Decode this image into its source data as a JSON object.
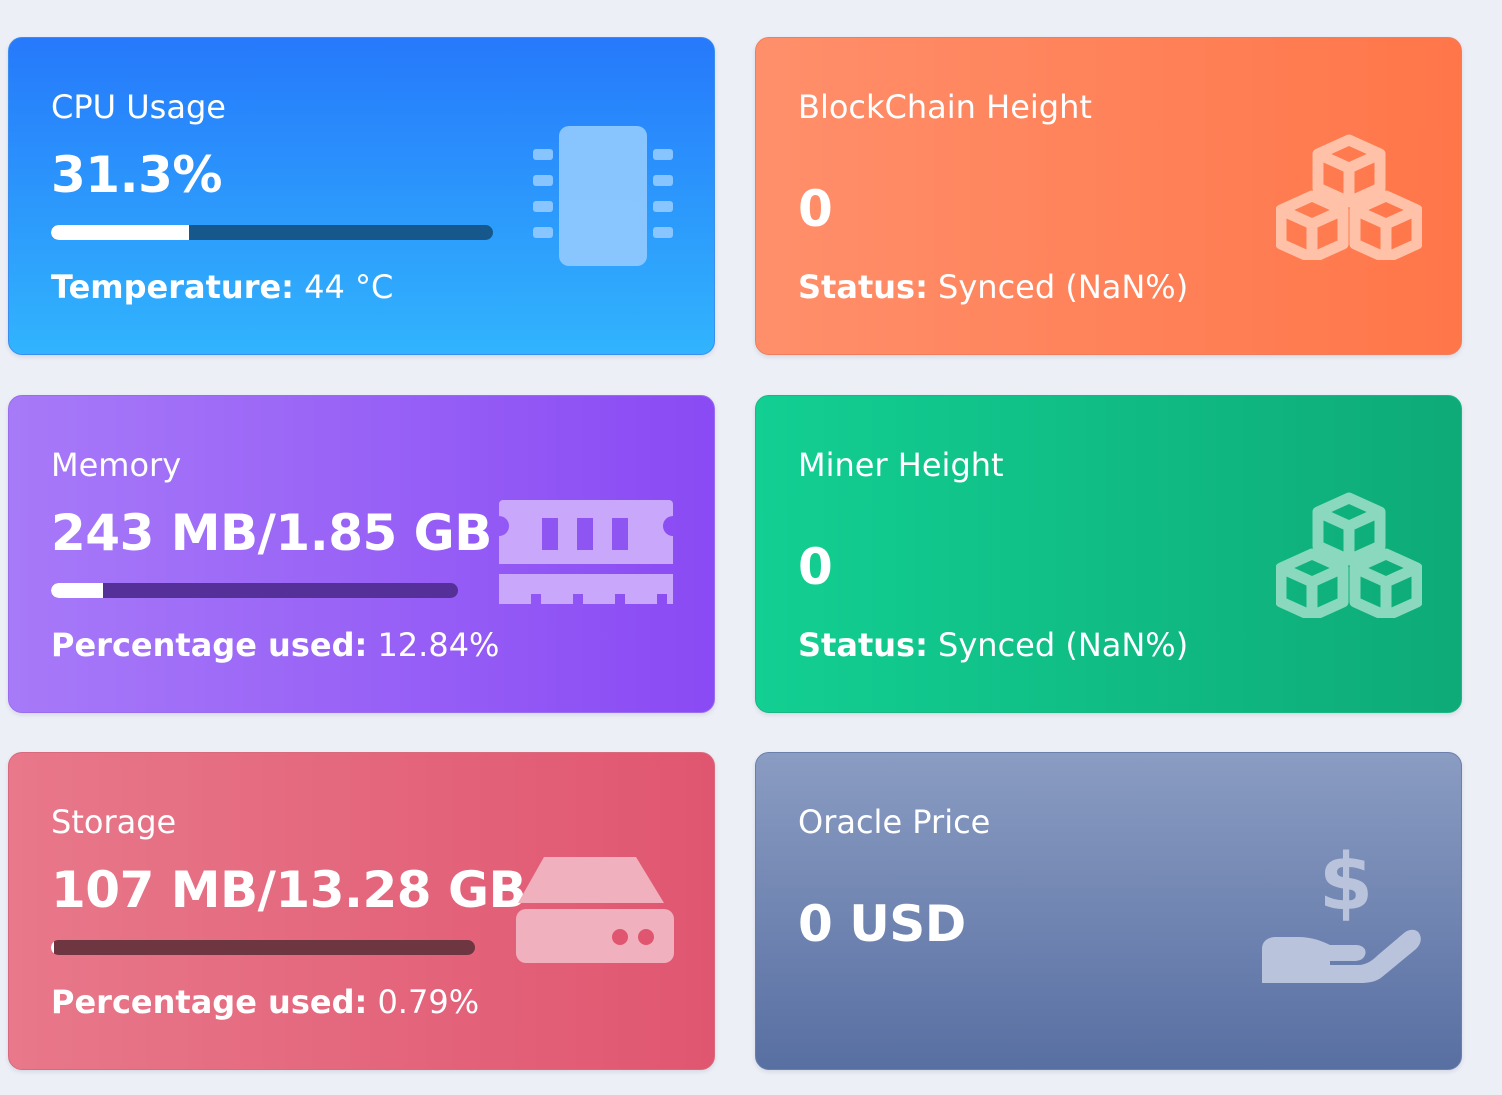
{
  "cards": {
    "cpu": {
      "title": "CPU Usage",
      "value": "31.3%",
      "progress": 0.313,
      "sub_label": "Temperature:",
      "sub_value": " 44 °C",
      "icon": "cpu-chip-icon",
      "color": "#2679fb"
    },
    "blockchain": {
      "title": "BlockChain Height",
      "value": "0",
      "sub_label": "Status:",
      "sub_value": " Synced (NaN%)",
      "icon": "cubes-icon",
      "color": "#ff7649"
    },
    "memory": {
      "title": "Memory",
      "value": "243 MB/1.85 GB",
      "progress": 0.1284,
      "sub_label": "Percentage used:",
      "sub_value": " 12.84%",
      "icon": "memory-module-icon",
      "color": "#8a4af4"
    },
    "miner": {
      "title": "Miner Height",
      "value": "0",
      "sub_label": "Status:",
      "sub_value": " Synced (NaN%)",
      "icon": "cubes-icon",
      "color": "#0eaa77"
    },
    "storage": {
      "title": "Storage",
      "value": "107 MB/13.28 GB",
      "progress": 0.0079,
      "sub_label": "Percentage used:",
      "sub_value": " 0.79%",
      "icon": "hard-drive-icon",
      "color": "#e05670"
    },
    "oracle": {
      "title": "Oracle Price",
      "value": "0 USD",
      "icon": "hand-dollar-icon",
      "color": "#586fa2"
    }
  }
}
